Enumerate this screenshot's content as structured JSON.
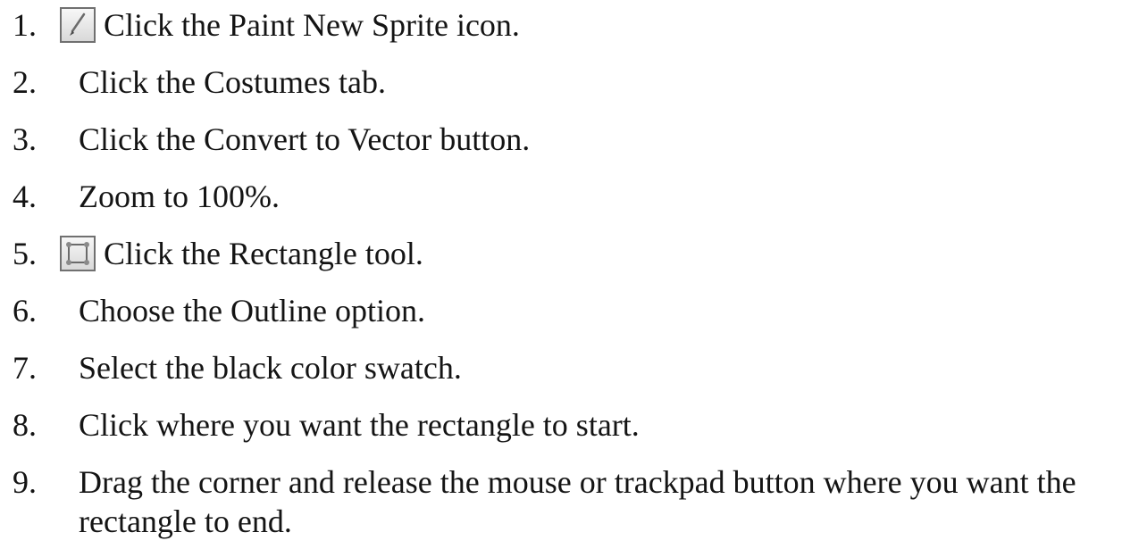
{
  "steps": [
    {
      "number": "1.",
      "icon": "paintbrush-icon",
      "text": "Click the Paint New Sprite icon."
    },
    {
      "number": "2.",
      "text": "Click the Costumes tab."
    },
    {
      "number": "3.",
      "text": "Click the Convert to Vector button."
    },
    {
      "number": "4.",
      "text": "Zoom to 100%."
    },
    {
      "number": "5.",
      "icon": "rectangle-tool-icon",
      "text": "Click the Rectangle tool."
    },
    {
      "number": "6.",
      "text": "Choose the Outline option."
    },
    {
      "number": "7.",
      "text": "Select the black color swatch."
    },
    {
      "number": "8.",
      "text": "Click where you want the rectangle to start."
    },
    {
      "number": "9.",
      "text": "Drag the corner and release the mouse or trackpad button where you want the",
      "text_continued": "rectangle to end."
    }
  ]
}
